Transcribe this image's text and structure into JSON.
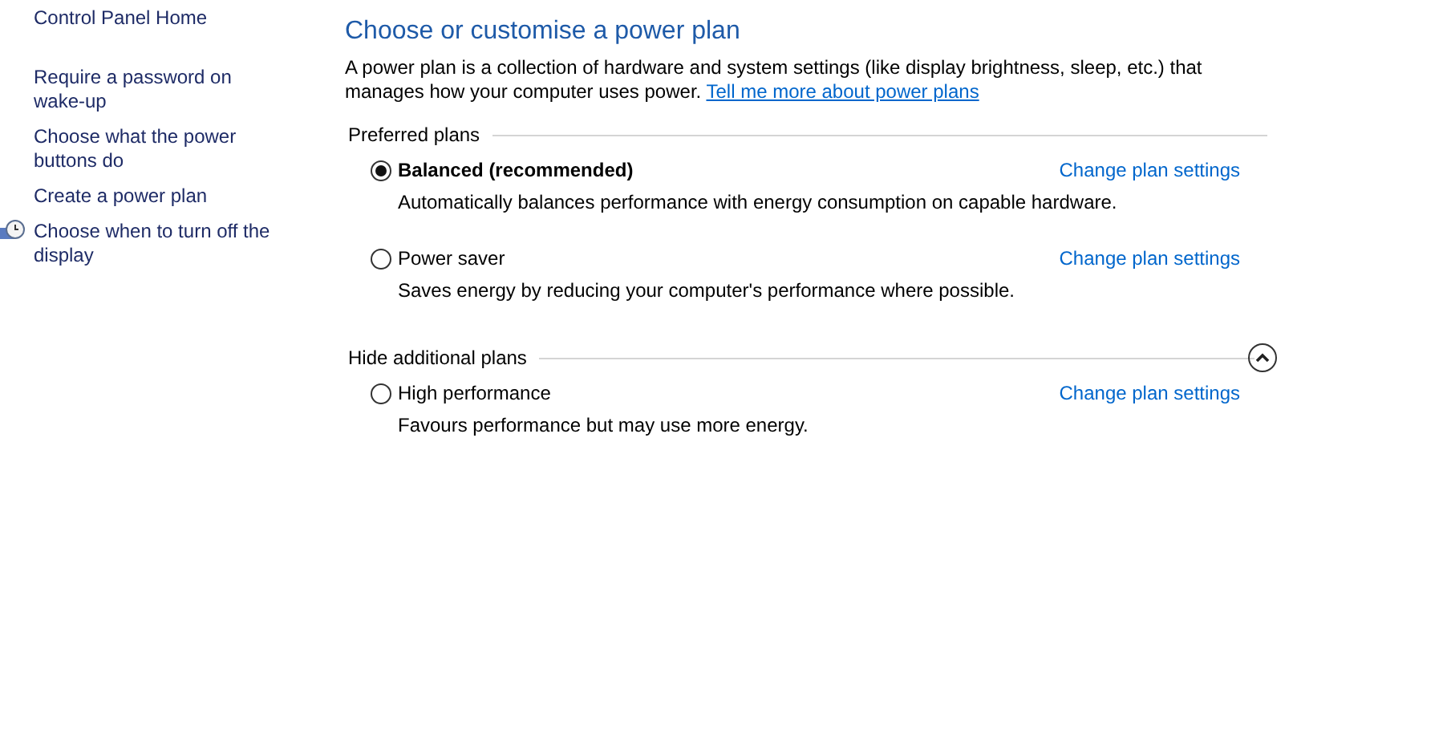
{
  "sidebar": {
    "home": "Control Panel Home",
    "links": [
      {
        "label": "Require a password on wake-up",
        "kind": "link"
      },
      {
        "label": "Choose what the power buttons do",
        "kind": "link"
      },
      {
        "label": "Create a power plan",
        "kind": "link"
      },
      {
        "label": "Choose when to turn off the display",
        "kind": "icon-link"
      }
    ]
  },
  "main": {
    "title": "Choose or customise a power plan",
    "description": "A power plan is a collection of hardware and system settings (like display brightness, sleep, etc.) that manages how your computer uses power.",
    "description_link": "Tell me more about power plans",
    "groups": [
      {
        "label": "Preferred plans",
        "plans": [
          {
            "name": "Balanced (recommended)",
            "selected": true,
            "description": "Automatically balances performance with energy consumption on capable hardware.",
            "link": "Change plan settings"
          },
          {
            "name": "Power saver",
            "selected": false,
            "description": "Saves energy by reducing your computer's performance where possible.",
            "link": "Change plan settings"
          }
        ]
      },
      {
        "label": "Hide additional plans",
        "expanded": true,
        "plans": [
          {
            "name": "High performance",
            "selected": false,
            "description": "Favours performance but may use more energy.",
            "link": "Change plan settings"
          }
        ]
      }
    ]
  }
}
